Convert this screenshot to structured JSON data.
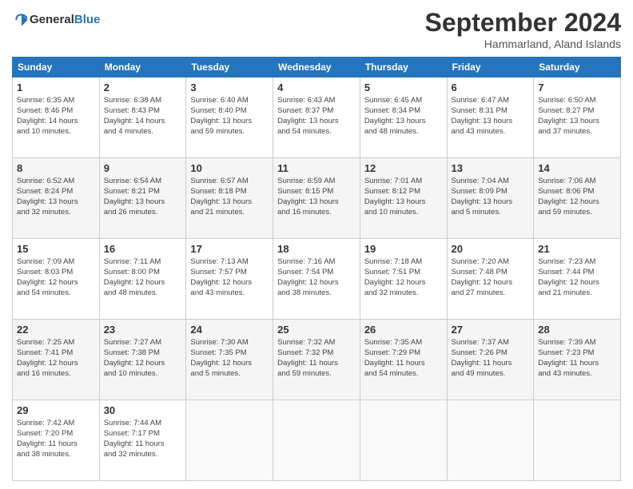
{
  "header": {
    "logo": "GeneralBlue",
    "month": "September 2024",
    "location": "Hammarland, Aland Islands"
  },
  "weekdays": [
    "Sunday",
    "Monday",
    "Tuesday",
    "Wednesday",
    "Thursday",
    "Friday",
    "Saturday"
  ],
  "rows": [
    [
      {
        "day": "1",
        "info": "Sunrise: 6:35 AM\nSunset: 8:46 PM\nDaylight: 14 hours\nand 10 minutes."
      },
      {
        "day": "2",
        "info": "Sunrise: 6:38 AM\nSunset: 8:43 PM\nDaylight: 14 hours\nand 4 minutes."
      },
      {
        "day": "3",
        "info": "Sunrise: 6:40 AM\nSunset: 8:40 PM\nDaylight: 13 hours\nand 59 minutes."
      },
      {
        "day": "4",
        "info": "Sunrise: 6:43 AM\nSunset: 8:37 PM\nDaylight: 13 hours\nand 54 minutes."
      },
      {
        "day": "5",
        "info": "Sunrise: 6:45 AM\nSunset: 8:34 PM\nDaylight: 13 hours\nand 48 minutes."
      },
      {
        "day": "6",
        "info": "Sunrise: 6:47 AM\nSunset: 8:31 PM\nDaylight: 13 hours\nand 43 minutes."
      },
      {
        "day": "7",
        "info": "Sunrise: 6:50 AM\nSunset: 8:27 PM\nDaylight: 13 hours\nand 37 minutes."
      }
    ],
    [
      {
        "day": "8",
        "info": "Sunrise: 6:52 AM\nSunset: 8:24 PM\nDaylight: 13 hours\nand 32 minutes."
      },
      {
        "day": "9",
        "info": "Sunrise: 6:54 AM\nSunset: 8:21 PM\nDaylight: 13 hours\nand 26 minutes."
      },
      {
        "day": "10",
        "info": "Sunrise: 6:57 AM\nSunset: 8:18 PM\nDaylight: 13 hours\nand 21 minutes."
      },
      {
        "day": "11",
        "info": "Sunrise: 6:59 AM\nSunset: 8:15 PM\nDaylight: 13 hours\nand 16 minutes."
      },
      {
        "day": "12",
        "info": "Sunrise: 7:01 AM\nSunset: 8:12 PM\nDaylight: 13 hours\nand 10 minutes."
      },
      {
        "day": "13",
        "info": "Sunrise: 7:04 AM\nSunset: 8:09 PM\nDaylight: 13 hours\nand 5 minutes."
      },
      {
        "day": "14",
        "info": "Sunrise: 7:06 AM\nSunset: 8:06 PM\nDaylight: 12 hours\nand 59 minutes."
      }
    ],
    [
      {
        "day": "15",
        "info": "Sunrise: 7:09 AM\nSunset: 8:03 PM\nDaylight: 12 hours\nand 54 minutes."
      },
      {
        "day": "16",
        "info": "Sunrise: 7:11 AM\nSunset: 8:00 PM\nDaylight: 12 hours\nand 48 minutes."
      },
      {
        "day": "17",
        "info": "Sunrise: 7:13 AM\nSunset: 7:57 PM\nDaylight: 12 hours\nand 43 minutes."
      },
      {
        "day": "18",
        "info": "Sunrise: 7:16 AM\nSunset: 7:54 PM\nDaylight: 12 hours\nand 38 minutes."
      },
      {
        "day": "19",
        "info": "Sunrise: 7:18 AM\nSunset: 7:51 PM\nDaylight: 12 hours\nand 32 minutes."
      },
      {
        "day": "20",
        "info": "Sunrise: 7:20 AM\nSunset: 7:48 PM\nDaylight: 12 hours\nand 27 minutes."
      },
      {
        "day": "21",
        "info": "Sunrise: 7:23 AM\nSunset: 7:44 PM\nDaylight: 12 hours\nand 21 minutes."
      }
    ],
    [
      {
        "day": "22",
        "info": "Sunrise: 7:25 AM\nSunset: 7:41 PM\nDaylight: 12 hours\nand 16 minutes."
      },
      {
        "day": "23",
        "info": "Sunrise: 7:27 AM\nSunset: 7:38 PM\nDaylight: 12 hours\nand 10 minutes."
      },
      {
        "day": "24",
        "info": "Sunrise: 7:30 AM\nSunset: 7:35 PM\nDaylight: 12 hours\nand 5 minutes."
      },
      {
        "day": "25",
        "info": "Sunrise: 7:32 AM\nSunset: 7:32 PM\nDaylight: 11 hours\nand 59 minutes."
      },
      {
        "day": "26",
        "info": "Sunrise: 7:35 AM\nSunset: 7:29 PM\nDaylight: 11 hours\nand 54 minutes."
      },
      {
        "day": "27",
        "info": "Sunrise: 7:37 AM\nSunset: 7:26 PM\nDaylight: 11 hours\nand 49 minutes."
      },
      {
        "day": "28",
        "info": "Sunrise: 7:39 AM\nSunset: 7:23 PM\nDaylight: 11 hours\nand 43 minutes."
      }
    ],
    [
      {
        "day": "29",
        "info": "Sunrise: 7:42 AM\nSunset: 7:20 PM\nDaylight: 11 hours\nand 38 minutes."
      },
      {
        "day": "30",
        "info": "Sunrise: 7:44 AM\nSunset: 7:17 PM\nDaylight: 11 hours\nand 32 minutes."
      },
      {
        "day": "",
        "info": ""
      },
      {
        "day": "",
        "info": ""
      },
      {
        "day": "",
        "info": ""
      },
      {
        "day": "",
        "info": ""
      },
      {
        "day": "",
        "info": ""
      }
    ]
  ]
}
